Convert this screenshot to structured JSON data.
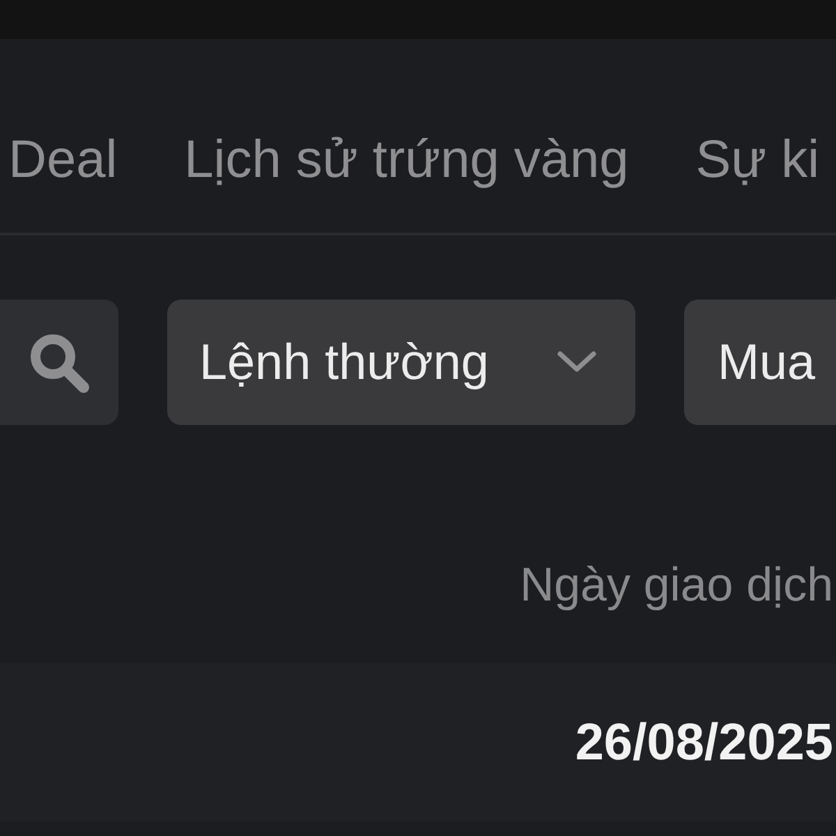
{
  "tabs": [
    {
      "label": "Deal",
      "selected": false
    },
    {
      "label": "Lịch sử trứng vàng",
      "selected": false
    },
    {
      "label": "Sự ki",
      "selected": false
    }
  ],
  "filters": [
    {
      "kind": "search"
    },
    {
      "kind": "dropdown",
      "value": "Lệnh thường"
    },
    {
      "kind": "chip",
      "value": "Mua"
    }
  ],
  "table": {
    "columns": [
      {
        "label": "Ngày giao dịch"
      }
    ],
    "rows": [
      [
        "26/08/2025"
      ]
    ]
  }
}
